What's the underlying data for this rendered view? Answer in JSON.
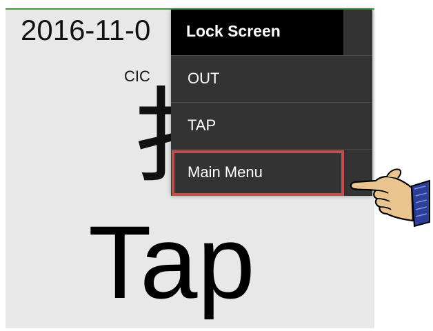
{
  "screen": {
    "date_text": "2016-11-0",
    "clock_label": "CIC",
    "glyph": "扌",
    "tap_text": "Tap"
  },
  "menu": {
    "header": "Lock Screen",
    "items": [
      {
        "label": "OUT"
      },
      {
        "label": "TAP"
      },
      {
        "label": "Main Menu"
      }
    ],
    "highlighted_item": "Main Menu"
  },
  "colors": {
    "menu_bg": "#333333",
    "menu_header_bg": "#000000",
    "highlight": "#c0504d",
    "screen_bg": "#e8e8e8",
    "status_strip": "#3d9a3d"
  },
  "icons": {
    "pointer": "pointing-hand-icon"
  }
}
